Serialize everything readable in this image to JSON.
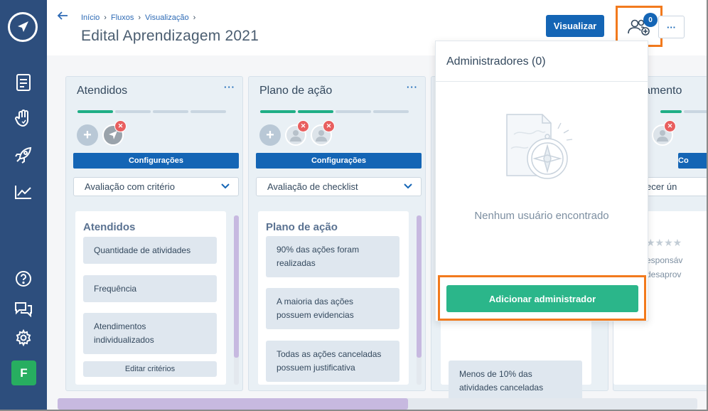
{
  "header": {
    "breadcrumb": [
      "Início",
      "Fluxos",
      "Visualização"
    ],
    "title": "Edital Aprendizagem 2021",
    "visualize_label": "Visualizar",
    "admin_count": "0",
    "more_label": "···"
  },
  "sidebar": {
    "user_initial": "F",
    "items": [
      "document-icon",
      "hand-heart-icon",
      "rocket-icon",
      "chart-icon",
      "help-icon",
      "chat-icon",
      "settings-icon"
    ]
  },
  "columns": [
    {
      "title": "Atendidos",
      "config_label": "Configurações",
      "select_value": "Avaliação com critério",
      "inner_title": "Atendidos",
      "cards": [
        "Quantidade de atividades",
        "Frequência",
        "Atendimentos individualizados"
      ],
      "edit_label": "Editar critérios"
    },
    {
      "title": "Plano de ação",
      "config_label": "Configurações",
      "select_value": "Avaliação de checklist",
      "inner_title": "Plano de ação",
      "cards": [
        "90% das ações foram realizadas",
        "A maioria das ações possuem evidencias",
        "Todas as ações canceladas possuem justificativa"
      ]
    },
    {
      "card_visible": "Menos de 10% das atividades canceladas"
    },
    {
      "title_partial": "amento",
      "config_partial": "Co",
      "select_partial": "ecer ún",
      "line1": "esponsáv",
      "line2": "desaprov"
    }
  ],
  "panel": {
    "title": "Administradores (0)",
    "empty_text": "Nenhum usuário encontrado",
    "add_button": "Adicionar administrador"
  },
  "colors": {
    "sidebar": "#2d4e7d",
    "primary": "#1465b5",
    "success": "#2bb68a",
    "highlight": "#f27a1d",
    "danger": "#e85f5f"
  }
}
